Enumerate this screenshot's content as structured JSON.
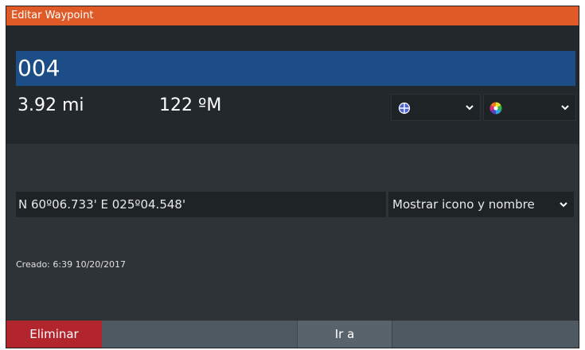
{
  "window": {
    "title": "Editar Waypoint"
  },
  "waypoint": {
    "name": "004",
    "distance": "3.92 mi",
    "bearing": "122 ºM",
    "coordinates": "N 60º06.733'   E 025º04.548'",
    "display_option": "Mostrar icono y nombre",
    "created": "Creado: 6:39   10/20/2017"
  },
  "symbol_select": {
    "icon": "waypoint-symbol-icon"
  },
  "color_select": {
    "icon": "color-wheel-icon"
  },
  "buttons": {
    "delete_label": "Eliminar",
    "goto_label": "Ir a"
  },
  "colors": {
    "title_bar": "#e05a27",
    "name_field": "#1c4d86",
    "delete_button": "#b3252d",
    "background": "#23282c"
  }
}
